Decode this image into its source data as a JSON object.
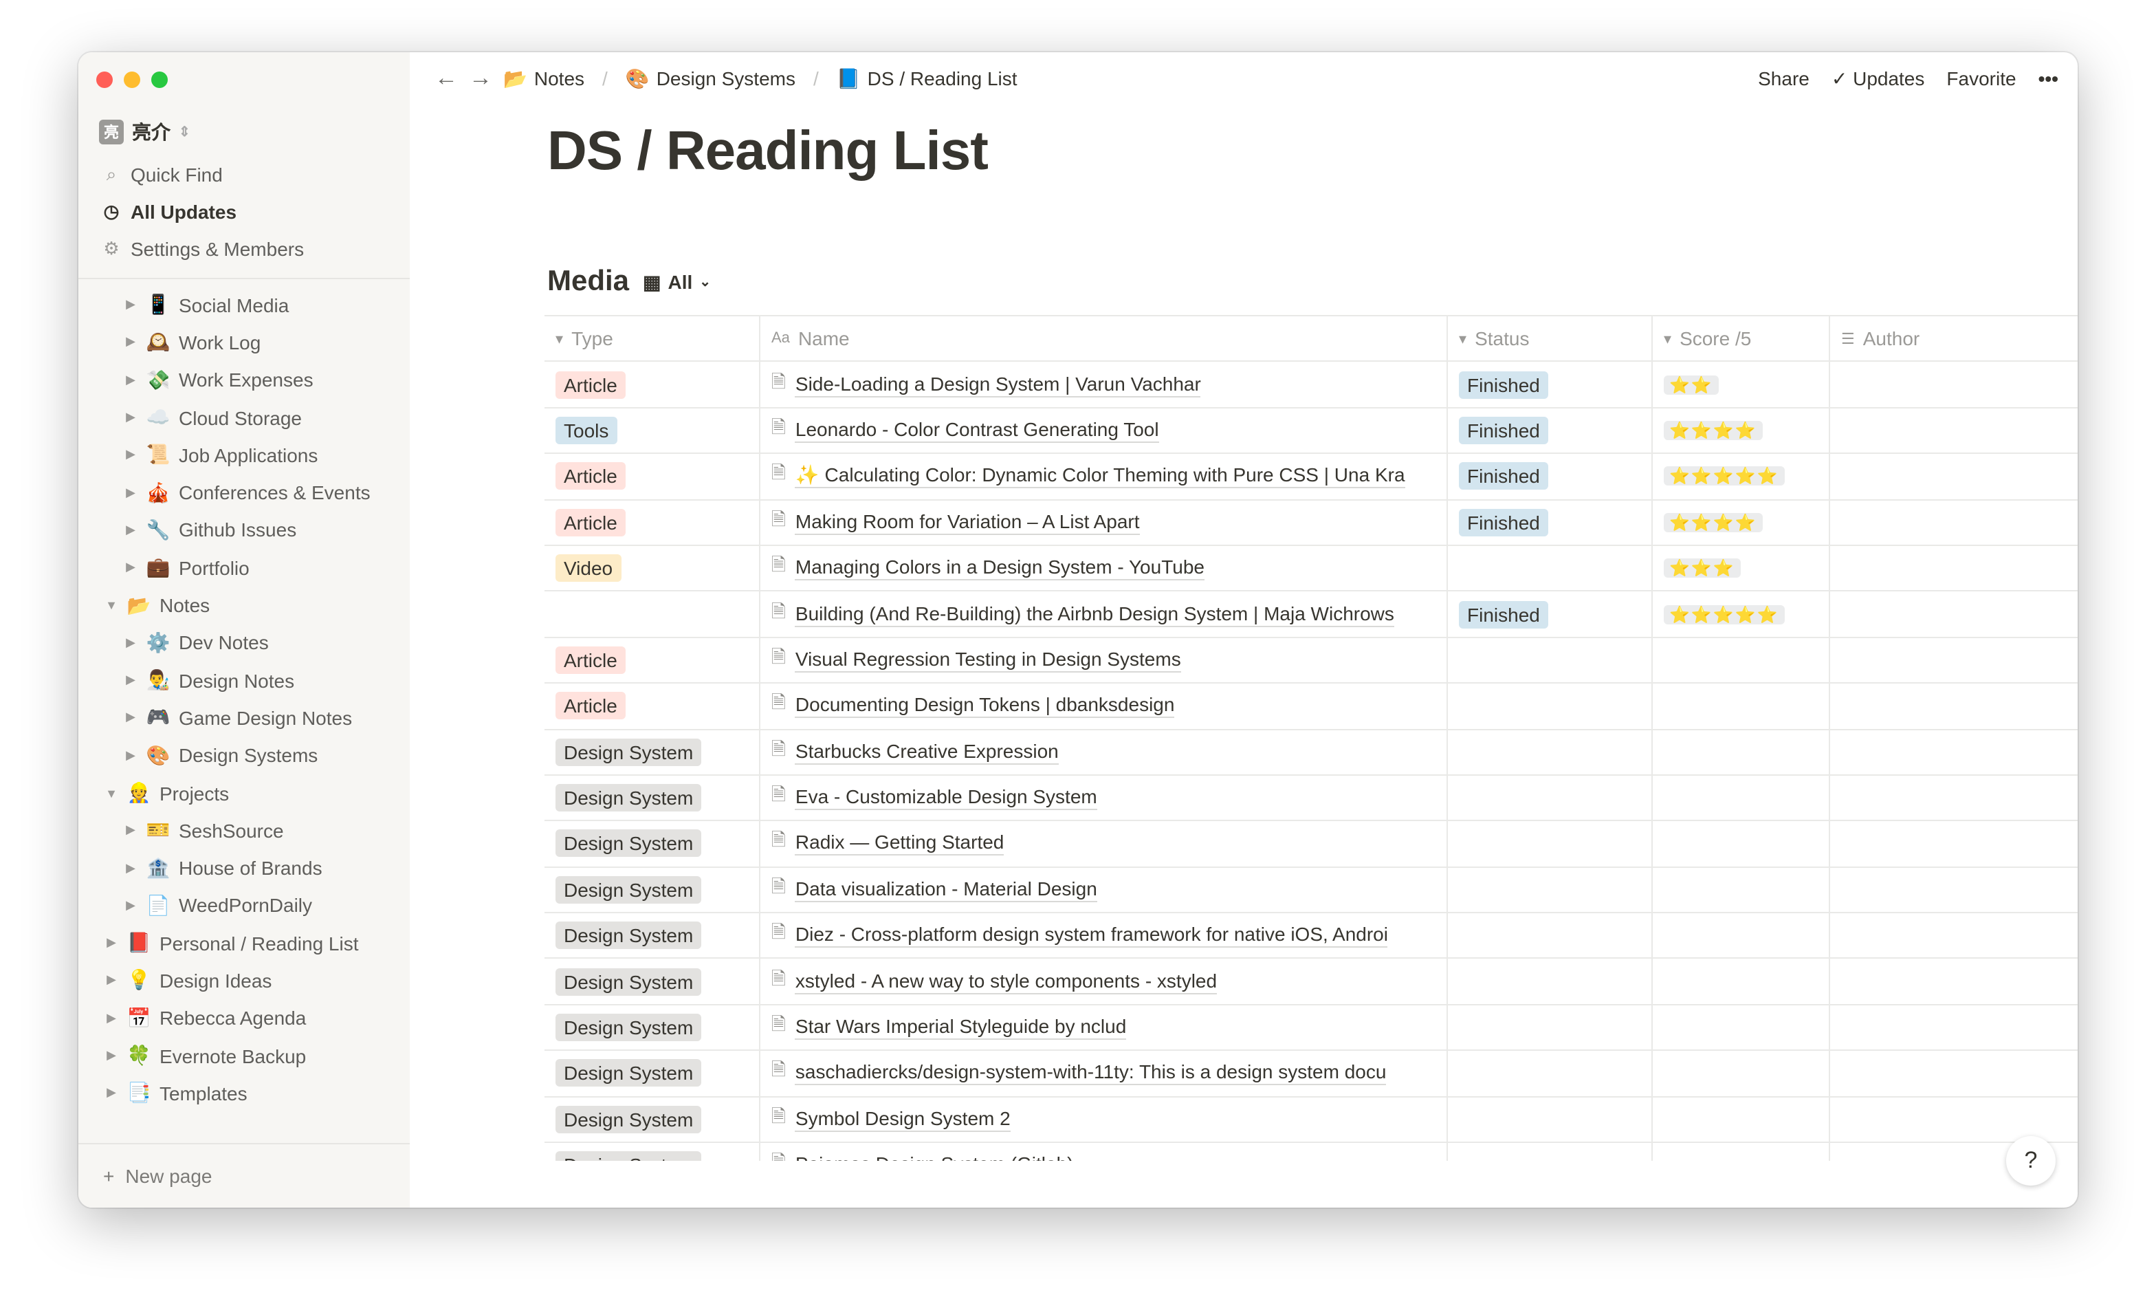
{
  "workspace": {
    "avatar": "亮",
    "name": "亮介"
  },
  "sidebar": {
    "nav": [
      {
        "label": "Quick Find",
        "icon": "search-icon"
      },
      {
        "label": "All Updates",
        "icon": "clock-icon"
      },
      {
        "label": "Settings & Members",
        "icon": "gear-icon"
      }
    ],
    "tree": [
      {
        "label": "Social Media",
        "emoji": "📱",
        "level": 1,
        "open": false
      },
      {
        "label": "Work Log",
        "emoji": "🕰️",
        "level": 1,
        "open": false
      },
      {
        "label": "Work Expenses",
        "emoji": "💸",
        "level": 1,
        "open": false
      },
      {
        "label": "Cloud Storage",
        "emoji": "☁️",
        "level": 1,
        "open": false
      },
      {
        "label": "Job Applications",
        "emoji": "📜",
        "level": 1,
        "open": false
      },
      {
        "label": "Conferences & Events",
        "emoji": "🎪",
        "level": 1,
        "open": false
      },
      {
        "label": "Github Issues",
        "emoji": "🔧",
        "level": 1,
        "open": false
      },
      {
        "label": "Portfolio",
        "emoji": "💼",
        "level": 1,
        "open": false
      },
      {
        "label": "Notes",
        "emoji": "📂",
        "level": 0,
        "open": true
      },
      {
        "label": "Dev Notes",
        "emoji": "⚙️",
        "level": 1,
        "open": false
      },
      {
        "label": "Design Notes",
        "emoji": "👨‍🎨",
        "level": 1,
        "open": false
      },
      {
        "label": "Game Design Notes",
        "emoji": "🎮",
        "level": 1,
        "open": false
      },
      {
        "label": "Design Systems",
        "emoji": "🎨",
        "level": 1,
        "open": false
      },
      {
        "label": "Projects",
        "emoji": "👷",
        "level": 0,
        "open": true
      },
      {
        "label": "SeshSource",
        "emoji": "🎫",
        "level": 1,
        "open": false
      },
      {
        "label": "House of Brands",
        "emoji": "🏦",
        "level": 1,
        "open": false
      },
      {
        "label": "WeedPornDaily",
        "emoji": "📄",
        "level": 1,
        "open": false
      },
      {
        "label": "Personal / Reading List",
        "emoji": "📕",
        "level": 0,
        "open": false
      },
      {
        "label": "Design Ideas",
        "emoji": "💡",
        "level": 0,
        "open": false
      },
      {
        "label": "Rebecca Agenda",
        "emoji": "📅",
        "level": 0,
        "open": false
      },
      {
        "label": "Evernote Backup",
        "emoji": "🍀",
        "level": 0,
        "open": false
      },
      {
        "label": "Templates",
        "emoji": "📑",
        "level": 0,
        "open": false
      }
    ],
    "new_page": "New page"
  },
  "breadcrumb": [
    {
      "label": "Notes",
      "emoji": "📂"
    },
    {
      "label": "Design Systems",
      "emoji": "🎨"
    },
    {
      "label": "DS / Reading List",
      "emoji": "📘"
    }
  ],
  "topbar": {
    "share": "Share",
    "updates": "Updates",
    "favorite": "Favorite",
    "more": "•••"
  },
  "page": {
    "title": "DS / Reading List"
  },
  "database": {
    "title": "Media",
    "view": "All",
    "columns": [
      "Type",
      "Name",
      "Status",
      "Score /5",
      "Author"
    ],
    "rows": [
      {
        "type": "Article",
        "name": "Side-Loading a Design System | Varun Vachhar",
        "status": "Finished",
        "score": 2
      },
      {
        "type": "Tools",
        "name": "Leonardo - Color Contrast Generating Tool",
        "status": "Finished",
        "score": 4
      },
      {
        "type": "Article",
        "name": "✨ Calculating Color: Dynamic Color Theming with Pure CSS | Una Kra",
        "status": "Finished",
        "score": 5
      },
      {
        "type": "Article",
        "name": "Making Room for Variation – A List Apart",
        "status": "Finished",
        "score": 4
      },
      {
        "type": "Video",
        "name": "Managing Colors in a Design System - YouTube",
        "status": "",
        "score": 3
      },
      {
        "type": "",
        "name": "Building (And Re-Building) the Airbnb Design System | Maja Wichrows",
        "status": "Finished",
        "score": 5
      },
      {
        "type": "Article",
        "name": "Visual Regression Testing in Design Systems",
        "status": "",
        "score": 0
      },
      {
        "type": "Article",
        "name": "Documenting Design Tokens | dbanksdesign",
        "status": "",
        "score": 0
      },
      {
        "type": "Design System",
        "name": "Starbucks Creative Expression",
        "status": "",
        "score": 0
      },
      {
        "type": "Design System",
        "name": "Eva - Customizable Design System",
        "status": "",
        "score": 0
      },
      {
        "type": "Design System",
        "name": "Radix — Getting Started",
        "status": "",
        "score": 0
      },
      {
        "type": "Design System",
        "name": "Data visualization - Material Design",
        "status": "",
        "score": 0
      },
      {
        "type": "Design System",
        "name": "Diez - Cross-platform design system framework for native iOS, Androi",
        "status": "",
        "score": 0
      },
      {
        "type": "Design System",
        "name": "xstyled - A new way to style components - xstyled",
        "status": "",
        "score": 0
      },
      {
        "type": "Design System",
        "name": "Star Wars Imperial Styleguide by nclud",
        "status": "",
        "score": 0
      },
      {
        "type": "Design System",
        "name": "saschadiercks/design-system-with-11ty: This is a design system docu",
        "status": "",
        "score": 0
      },
      {
        "type": "Design System",
        "name": "Symbol Design System 2",
        "status": "",
        "score": 0
      },
      {
        "type": "Design System",
        "name": "Pajamas Design System (Gitlab)",
        "status": "",
        "score": 0
      }
    ]
  },
  "tag_colors": {
    "Article": "#ffe2dd",
    "Tools": "#d3e5ef",
    "Video": "#fdecc8",
    "Design System": "#e3e2e0",
    "Finished": "#d3e5ef"
  },
  "help": "?"
}
